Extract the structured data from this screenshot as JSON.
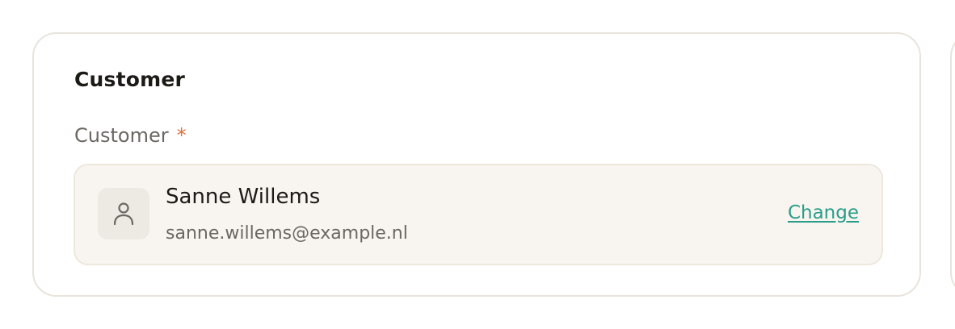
{
  "card": {
    "title": "Customer"
  },
  "customer_field": {
    "label": "Customer",
    "required_marker": "*",
    "selected": {
      "name": "Sanne Willems",
      "email": "sanne.willems@example.nl",
      "avatar_icon": "user-icon"
    },
    "change_label": "Change"
  },
  "colors": {
    "accent": "#2a9d8a",
    "required": "#e06f3c",
    "card_border": "#e8e4dc",
    "selection_background": "#f8f5f0"
  }
}
